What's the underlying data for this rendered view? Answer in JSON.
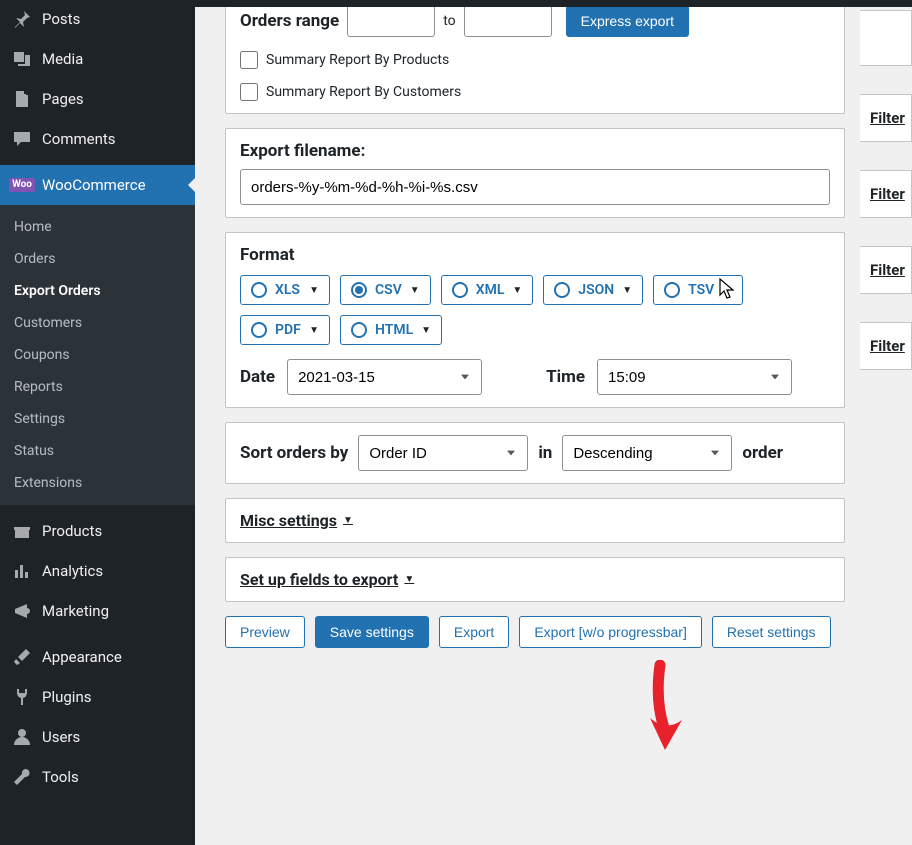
{
  "sidebar": {
    "items": [
      {
        "label": "Posts",
        "icon": "pin"
      },
      {
        "label": "Media",
        "icon": "media"
      },
      {
        "label": "Pages",
        "icon": "page"
      },
      {
        "label": "Comments",
        "icon": "comment"
      }
    ],
    "woocommerce_label": "WooCommerce",
    "woo_sub": [
      {
        "label": "Home"
      },
      {
        "label": "Orders"
      },
      {
        "label": "Export Orders",
        "active": true
      },
      {
        "label": "Customers"
      },
      {
        "label": "Coupons"
      },
      {
        "label": "Reports"
      },
      {
        "label": "Settings"
      },
      {
        "label": "Status"
      },
      {
        "label": "Extensions"
      }
    ],
    "lower": [
      {
        "label": "Products",
        "icon": "products"
      },
      {
        "label": "Analytics",
        "icon": "analytics"
      },
      {
        "label": "Marketing",
        "icon": "marketing"
      }
    ],
    "admin": [
      {
        "label": "Appearance",
        "icon": "brush"
      },
      {
        "label": "Plugins",
        "icon": "plug"
      },
      {
        "label": "Users",
        "icon": "user"
      },
      {
        "label": "Tools",
        "icon": "wrench"
      }
    ]
  },
  "orders_range": {
    "label": "Orders range",
    "to": "to",
    "express": "Express export",
    "summary_products": "Summary Report By Products",
    "summary_customers": "Summary Report By Customers"
  },
  "filename": {
    "label": "Export filename:",
    "value": "orders-%y-%m-%d-%h-%i-%s.csv"
  },
  "format": {
    "label": "Format",
    "options": [
      "XLS",
      "CSV",
      "XML",
      "JSON",
      "TSV",
      "PDF",
      "HTML"
    ],
    "selected": "CSV",
    "date_label": "Date",
    "date_value": "2021-03-15",
    "time_label": "Time",
    "time_value": "15:09"
  },
  "sort": {
    "label": "Sort orders by",
    "field": "Order ID",
    "in": "in",
    "dir": "Descending",
    "suffix": "order"
  },
  "misc_label": "Misc settings",
  "fields_label": "Set up fields to export",
  "actions": {
    "preview": "Preview",
    "save": "Save settings",
    "export": "Export",
    "export_np": "Export [w/o progressbar]",
    "reset": "Reset settings"
  },
  "filter_stub": "Filter"
}
